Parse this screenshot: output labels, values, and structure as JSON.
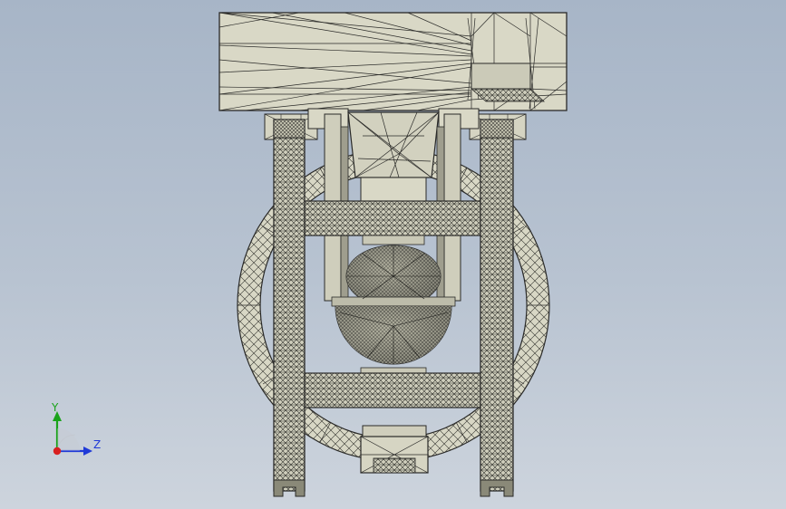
{
  "viewport": {
    "background_top": "#a7b5c7",
    "background_bottom": "#cdd4dd",
    "model_fill": "#d9d8c6",
    "model_stroke": "#2a2a28"
  },
  "triad": {
    "y_label": "Y",
    "z_label": "Z",
    "y_color": "#1aa31a",
    "z_color": "#1f3ad8",
    "origin_color": "#d82020"
  }
}
